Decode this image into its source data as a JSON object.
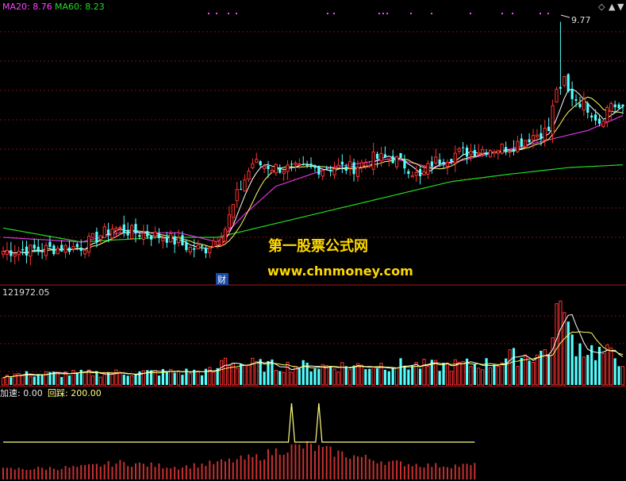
{
  "chart_data": [
    {
      "type": "candlestick",
      "legend": [
        {
          "text": "MA20: 8.76",
          "color": "#ff44ff"
        },
        {
          "text": "MA60: 8.23",
          "color": "#22dd22"
        }
      ],
      "annotations": {
        "high_label": "9.77",
        "event_marker": "财"
      },
      "watermark": {
        "title": "第一股票公式网",
        "url": "www.chnmoney.com"
      },
      "ylim": [
        7.1,
        9.85
      ],
      "anchors": [
        [
          0,
          7.3
        ],
        [
          10,
          7.32
        ],
        [
          20,
          7.35
        ],
        [
          28,
          7.55
        ],
        [
          34,
          7.5
        ],
        [
          42,
          7.45
        ],
        [
          48,
          7.33
        ],
        [
          52,
          7.33
        ],
        [
          57,
          7.55
        ],
        [
          60,
          7.9
        ],
        [
          64,
          8.25
        ],
        [
          70,
          8.2
        ],
        [
          76,
          8.18
        ],
        [
          84,
          8.2
        ],
        [
          90,
          8.2
        ],
        [
          95,
          8.3
        ],
        [
          100,
          8.3
        ],
        [
          104,
          8.2
        ],
        [
          107,
          8.08
        ],
        [
          110,
          8.25
        ],
        [
          116,
          8.35
        ],
        [
          124,
          8.4
        ],
        [
          130,
          8.42
        ],
        [
          136,
          8.55
        ],
        [
          140,
          8.6
        ],
        [
          143,
          9.3
        ],
        [
          145,
          9.0
        ],
        [
          150,
          8.85
        ],
        [
          153,
          8.7
        ],
        [
          156,
          8.9
        ],
        [
          159,
          8.8
        ]
      ],
      "ma20_anchors": [
        [
          0,
          7.45
        ],
        [
          20,
          7.4
        ],
        [
          30,
          7.5
        ],
        [
          45,
          7.5
        ],
        [
          55,
          7.4
        ],
        [
          62,
          7.7
        ],
        [
          70,
          8.0
        ],
        [
          84,
          8.2
        ],
        [
          100,
          8.3
        ],
        [
          110,
          8.2
        ],
        [
          125,
          8.35
        ],
        [
          140,
          8.5
        ],
        [
          150,
          8.6
        ],
        [
          159,
          8.76
        ]
      ],
      "ma60_anchors": [
        [
          0,
          7.55
        ],
        [
          20,
          7.4
        ],
        [
          40,
          7.45
        ],
        [
          55,
          7.45
        ],
        [
          70,
          7.6
        ],
        [
          85,
          7.75
        ],
        [
          100,
          7.9
        ],
        [
          115,
          8.05
        ],
        [
          130,
          8.13
        ],
        [
          145,
          8.2
        ],
        [
          159,
          8.23
        ]
      ],
      "high_index": 143,
      "high_value": 9.77
    },
    {
      "type": "bar",
      "legend": [
        {
          "text": "121972.05",
          "color": "#dddddd"
        }
      ],
      "vol_anchors": [
        [
          0,
          0.12
        ],
        [
          30,
          0.14
        ],
        [
          55,
          0.16
        ],
        [
          56,
          0.3
        ],
        [
          60,
          0.25
        ],
        [
          70,
          0.22
        ],
        [
          90,
          0.22
        ],
        [
          100,
          0.24
        ],
        [
          110,
          0.22
        ],
        [
          125,
          0.25
        ],
        [
          130,
          0.32
        ],
        [
          138,
          0.36
        ],
        [
          141,
          0.5
        ],
        [
          143,
          0.95
        ],
        [
          145,
          0.6
        ],
        [
          148,
          0.45
        ],
        [
          159,
          0.3
        ]
      ]
    },
    {
      "type": "line",
      "legend": [
        {
          "text": "加速: 0.00",
          "color": "#e8e8e8"
        },
        {
          "text": "回踩: 200.00",
          "color": "#ffff80"
        }
      ],
      "bar_anchors": [
        [
          0,
          0.18
        ],
        [
          20,
          0.22
        ],
        [
          30,
          0.3
        ],
        [
          45,
          0.22
        ],
        [
          55,
          0.3
        ],
        [
          65,
          0.4
        ],
        [
          72,
          0.55
        ],
        [
          78,
          0.6
        ],
        [
          84,
          0.5
        ],
        [
          90,
          0.42
        ],
        [
          100,
          0.3
        ],
        [
          110,
          0.25
        ],
        [
          121,
          0.25
        ]
      ],
      "spikes": [
        74,
        81
      ]
    }
  ]
}
